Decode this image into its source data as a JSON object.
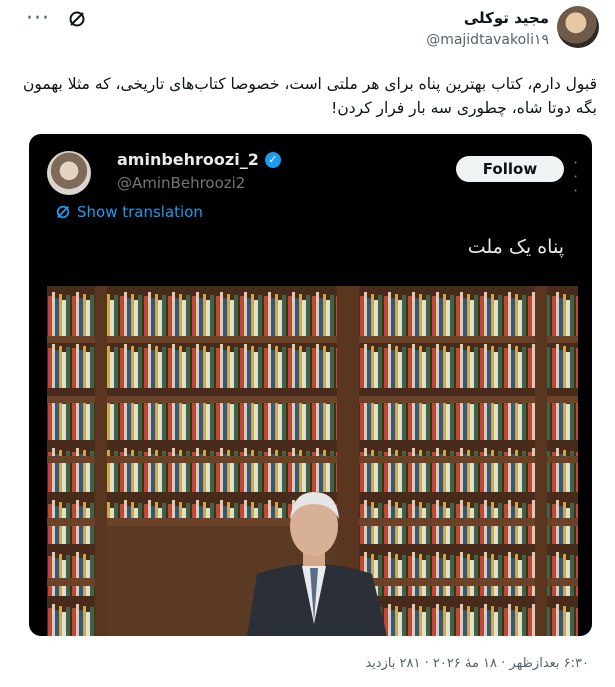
{
  "author": {
    "name": "مجید توکلی",
    "handle": "@majidtavakoli۱۹"
  },
  "tweet_text": "قبول دارم، کتاب بهترین پناه برای هر ملتی است، خصوصا کتاب‌های تاریخی، که مثلا بهمون بگه دوتا شاه، چطوری سه بار فرار کردن!",
  "quoted": {
    "name": "aminbehroozi_2",
    "handle": "@AminBehroozi2",
    "follow_label": "Follow",
    "show_translation": "Show translation",
    "text": "پناه یک ملت"
  },
  "footer": {
    "meta": "۶:۳۰ بعدازظهر · ۱۸ مهٔ ۲۰۲۶ · ۲۸۱ بازدید"
  },
  "icons": {
    "more": "more-icon",
    "grok": "grok-icon",
    "verified": "verified-badge-icon",
    "translate": "translate-icon"
  },
  "colors": {
    "link": "#1d9bf0",
    "card_bg": "#000000"
  }
}
